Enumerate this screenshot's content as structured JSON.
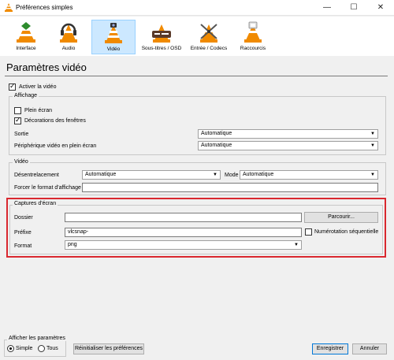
{
  "window": {
    "title": "Préférences simples",
    "controls": {
      "minimize": "—",
      "maximize": "☐",
      "close": "✕"
    }
  },
  "categories": [
    {
      "label": "Interface",
      "icon": "interface-icon"
    },
    {
      "label": "Audio",
      "icon": "audio-icon"
    },
    {
      "label": "Vidéo",
      "icon": "video-icon",
      "active": true
    },
    {
      "label": "Sous-titres / OSD",
      "icon": "subtitles-icon"
    },
    {
      "label": "Entrée / Codecs",
      "icon": "codecs-icon"
    },
    {
      "label": "Raccourcis",
      "icon": "hotkeys-icon"
    }
  ],
  "page_title": "Paramètres vidéo",
  "enable_video": {
    "label": "Activer la vidéo",
    "checked": true
  },
  "display": {
    "title": "Affichage",
    "fullscreen": {
      "label": "Plein écran",
      "checked": false
    },
    "decorations": {
      "label": "Décorations des fenêtres",
      "checked": true
    },
    "output": {
      "label": "Sortie",
      "value": "Automatique"
    },
    "fullscreen_device": {
      "label": "Périphérique vidéo en plein écran",
      "value": "Automatique"
    }
  },
  "video": {
    "title": "Vidéo",
    "deinterlace": {
      "label": "Désentrelacement",
      "value": "Automatique"
    },
    "mode": {
      "label": "Mode",
      "value": "Automatique"
    },
    "force_format": {
      "label": "Forcer le format d'affichage",
      "value": ""
    }
  },
  "snapshots": {
    "title": "Captures d'écran",
    "folder": {
      "label": "Dossier",
      "value": ""
    },
    "browse_label": "Parcourir...",
    "prefix": {
      "label": "Préfixe",
      "value": "vlcsnap-"
    },
    "sequential": {
      "label": "Numérotation séquentielle",
      "checked": false
    },
    "format": {
      "label": "Format",
      "value": "png"
    }
  },
  "footer": {
    "show_settings_title": "Afficher les paramètres",
    "simple_label": "Simple",
    "all_label": "Tous",
    "reset_label": "Réinitialiser les préférences",
    "save_label": "Enregistrer",
    "cancel_label": "Annuler"
  },
  "colors": {
    "highlight": "#d9282f",
    "active_tab": "#cce8ff",
    "accent": "#0078d7"
  }
}
